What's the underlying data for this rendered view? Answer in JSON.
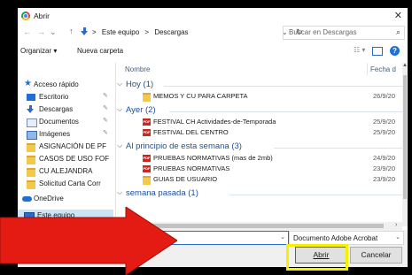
{
  "window": {
    "title": "Abrir",
    "close_glyph": "✕"
  },
  "nav": {
    "back_glyph": "←",
    "forward_glyph": "→",
    "up_glyph": "↑",
    "breadcrumb": [
      "Este equipo",
      "Descargas"
    ],
    "separator": ">",
    "search_placeholder": "Buscar en Descargas"
  },
  "toolbar": {
    "organize": "Organizar ▾",
    "new_folder": "Nueva carpeta"
  },
  "sidebar": {
    "items": [
      {
        "label": "Acceso rápido",
        "icon": "star-icon"
      },
      {
        "label": "Escritorio",
        "icon": "desktop-icon",
        "pinned": true
      },
      {
        "label": "Descargas",
        "icon": "download-icon",
        "pinned": true
      },
      {
        "label": "Documentos",
        "icon": "documents-icon",
        "pinned": true
      },
      {
        "label": "Imágenes",
        "icon": "pictures-icon",
        "pinned": true
      },
      {
        "label": "ASIGNACIÓN DE PF",
        "icon": "folder-icon"
      },
      {
        "label": "CASOS DE USO FOF",
        "icon": "folder-icon"
      },
      {
        "label": "CU ALEJANDRA",
        "icon": "folder-icon"
      },
      {
        "label": "Solicitud Carta Corr",
        "icon": "folder-icon"
      },
      {
        "label": "OneDrive",
        "icon": "cloud-icon"
      },
      {
        "label": "Este equipo",
        "icon": "computer-icon"
      }
    ]
  },
  "list": {
    "columns": {
      "name": "Nombre",
      "date": "Fecha d"
    },
    "groups": [
      {
        "label": "Hoy (1)",
        "rows": [
          {
            "name": "MEMOS Y CU PARA CARPETA",
            "date": "26/9/20",
            "type": "folder"
          }
        ]
      },
      {
        "label": "Ayer (2)",
        "rows": [
          {
            "name": "FESTIVAL CH Actividades-de-Temporada",
            "date": "25/9/20",
            "type": "pdf"
          },
          {
            "name": "FESTIVAL DEL CENTRO",
            "date": "25/9/20",
            "type": "pdf"
          }
        ]
      },
      {
        "label": "Al principio de esta semana (3)",
        "rows": [
          {
            "name": "PRUEBAS NORMATIVAS (mas de 2mb)",
            "date": "24/9/20",
            "type": "pdf"
          },
          {
            "name": "PRUEBAS NORMATIVAS",
            "date": "23/9/20",
            "type": "pdf"
          },
          {
            "name": "GUIAS DE USUARIO",
            "date": "23/9/20",
            "type": "folder"
          }
        ]
      },
      {
        "label": "semana pasada (1)",
        "rows": []
      }
    ]
  },
  "bottom": {
    "filename_value": "",
    "filetype": "Documento Adobe Acrobat",
    "open_button": "Abrir",
    "cancel_button": "Cancelar"
  },
  "colors": {
    "accent": "#1e6fd9",
    "highlight": "#f5ef00",
    "arrow": "#e41b13"
  }
}
